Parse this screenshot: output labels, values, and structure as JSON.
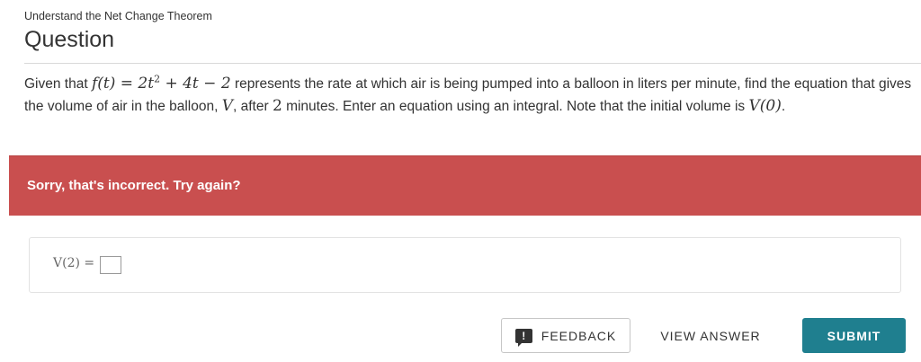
{
  "breadcrumb": "Understand the Net Change Theorem",
  "heading": "Question",
  "question": {
    "t1": "Given that ",
    "m1": "f(t) = 2t",
    "m1_exp": "2",
    "m1_rest": " + 4t − 2",
    "t2": " represents the rate at which air is being pumped into a balloon in liters per minute, find the equation that  gives the volume of air in the balloon, ",
    "m2": "V",
    "t3": ", after ",
    "m3": "2",
    "t4": " minutes. Enter an equation using an integral. Note that the initial volume is ",
    "m4": "V(0)",
    "t5": "."
  },
  "feedback_banner": {
    "text": "Sorry, that's incorrect. Try again?",
    "color": "#c94f4f"
  },
  "answer": {
    "label": "V(2) =",
    "value": ""
  },
  "buttons": {
    "feedback": "FEEDBACK",
    "feedback_icon": "feedback-speech-bubble-icon",
    "view_answer": "VIEW ANSWER",
    "submit": "SUBMIT",
    "submit_color": "#1f7f8f"
  }
}
